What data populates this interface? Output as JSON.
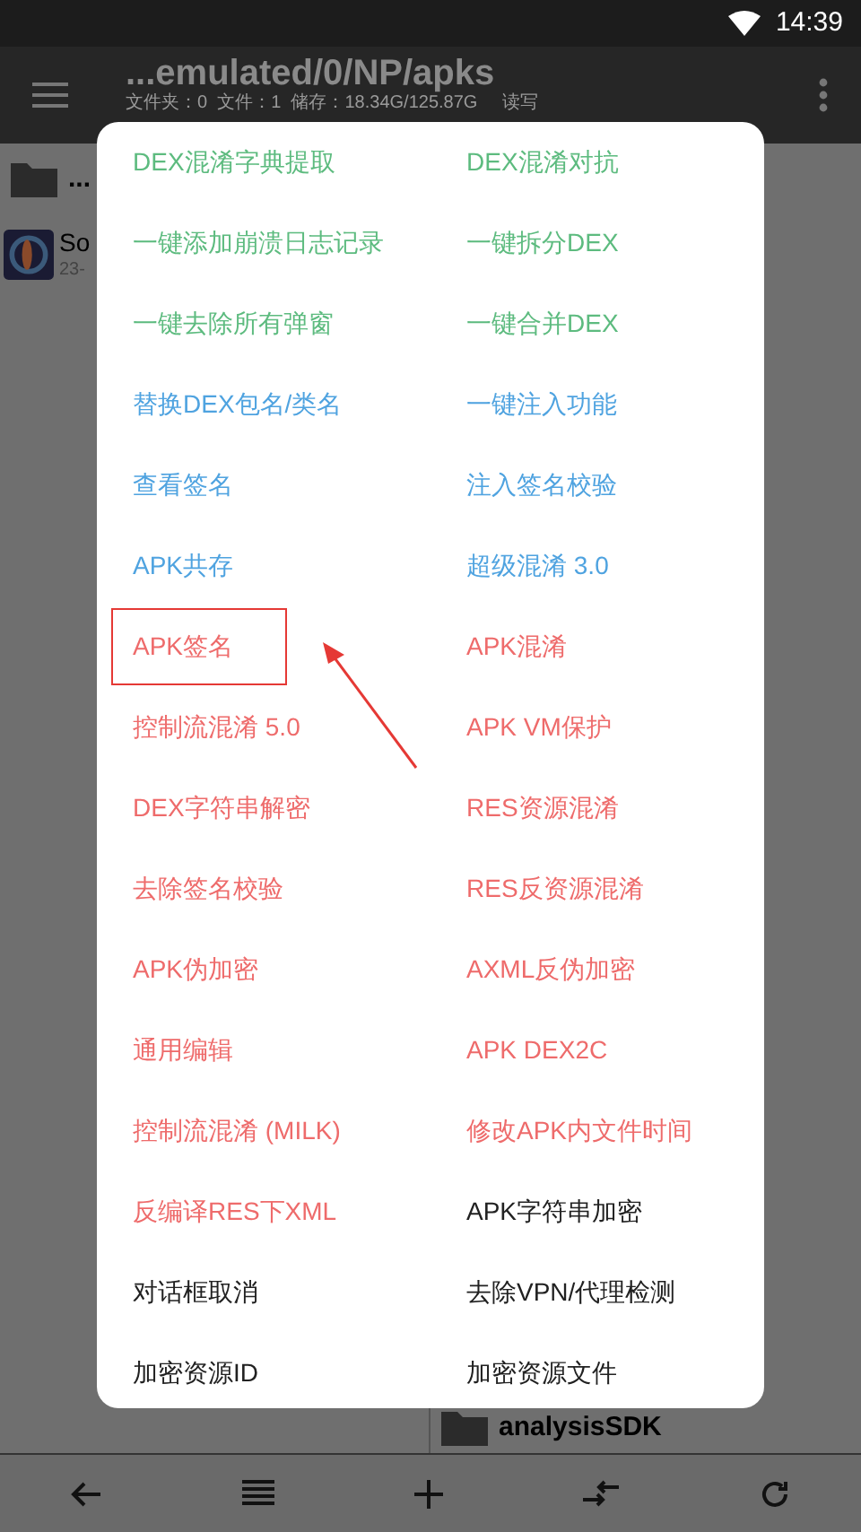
{
  "status_bar": {
    "time": "14:39"
  },
  "toolbar": {
    "title": "...emulated/0/NP/apks",
    "subtitle": "文件夹：0  文件：1  储存：18.34G/125.87G     读写"
  },
  "files_left": [
    {
      "kind": "folder",
      "name": "..."
    },
    {
      "kind": "app",
      "name": "So",
      "detail": "23-"
    }
  ],
  "files_right": [
    {
      "kind": "folder",
      "name": "analysisSDK"
    }
  ],
  "menu": {
    "items": [
      {
        "label": "DEX混淆字典提取",
        "color": "#5dbb7f",
        "highlighted": false
      },
      {
        "label": "DEX混淆对抗",
        "color": "#5dbb7f",
        "highlighted": false
      },
      {
        "label": "一键添加崩溃日志记录",
        "color": "#5dbb7f",
        "highlighted": false
      },
      {
        "label": "一键拆分DEX",
        "color": "#5dbb7f",
        "highlighted": false
      },
      {
        "label": "一键去除所有弹窗",
        "color": "#5dbb7f",
        "highlighted": false
      },
      {
        "label": "一键合并DEX",
        "color": "#5dbb7f",
        "highlighted": false
      },
      {
        "label": "替换DEX包名/类名",
        "color": "#4fa3e0",
        "highlighted": false
      },
      {
        "label": "一键注入功能",
        "color": "#4fa3e0",
        "highlighted": false
      },
      {
        "label": "查看签名",
        "color": "#4fa3e0",
        "highlighted": false
      },
      {
        "label": "注入签名校验",
        "color": "#4fa3e0",
        "highlighted": false
      },
      {
        "label": "APK共存",
        "color": "#4fa3e0",
        "highlighted": false
      },
      {
        "label": "超级混淆 3.0",
        "color": "#4fa3e0",
        "highlighted": false
      },
      {
        "label": "APK签名",
        "color": "#ee6b6b",
        "highlighted": true
      },
      {
        "label": "APK混淆",
        "color": "#ee6b6b",
        "highlighted": false
      },
      {
        "label": "控制流混淆 5.0",
        "color": "#ee6b6b",
        "highlighted": false
      },
      {
        "label": "APK VM保护",
        "color": "#ee6b6b",
        "highlighted": false
      },
      {
        "label": "DEX字符串解密",
        "color": "#ee6b6b",
        "highlighted": false
      },
      {
        "label": "RES资源混淆",
        "color": "#ee6b6b",
        "highlighted": false
      },
      {
        "label": "去除签名校验",
        "color": "#ee6b6b",
        "highlighted": false
      },
      {
        "label": "RES反资源混淆",
        "color": "#ee6b6b",
        "highlighted": false
      },
      {
        "label": "APK伪加密",
        "color": "#ee6b6b",
        "highlighted": false
      },
      {
        "label": "AXML反伪加密",
        "color": "#ee6b6b",
        "highlighted": false
      },
      {
        "label": "通用编辑",
        "color": "#ee6b6b",
        "highlighted": false
      },
      {
        "label": "APK DEX2C",
        "color": "#ee6b6b",
        "highlighted": false
      },
      {
        "label": "控制流混淆 (MILK)",
        "color": "#ee6b6b",
        "highlighted": false
      },
      {
        "label": "修改APK内文件时间",
        "color": "#ee6b6b",
        "highlighted": false
      },
      {
        "label": "反编译RES下XML",
        "color": "#ee6b6b",
        "highlighted": false
      },
      {
        "label": "APK字符串加密",
        "color": "#212121",
        "highlighted": false
      },
      {
        "label": "对话框取消",
        "color": "#212121",
        "highlighted": false
      },
      {
        "label": "去除VPN/代理检测",
        "color": "#212121",
        "highlighted": false
      },
      {
        "label": "加密资源ID",
        "color": "#212121",
        "highlighted": false
      },
      {
        "label": "加密资源文件",
        "color": "#212121",
        "highlighted": false
      }
    ]
  }
}
